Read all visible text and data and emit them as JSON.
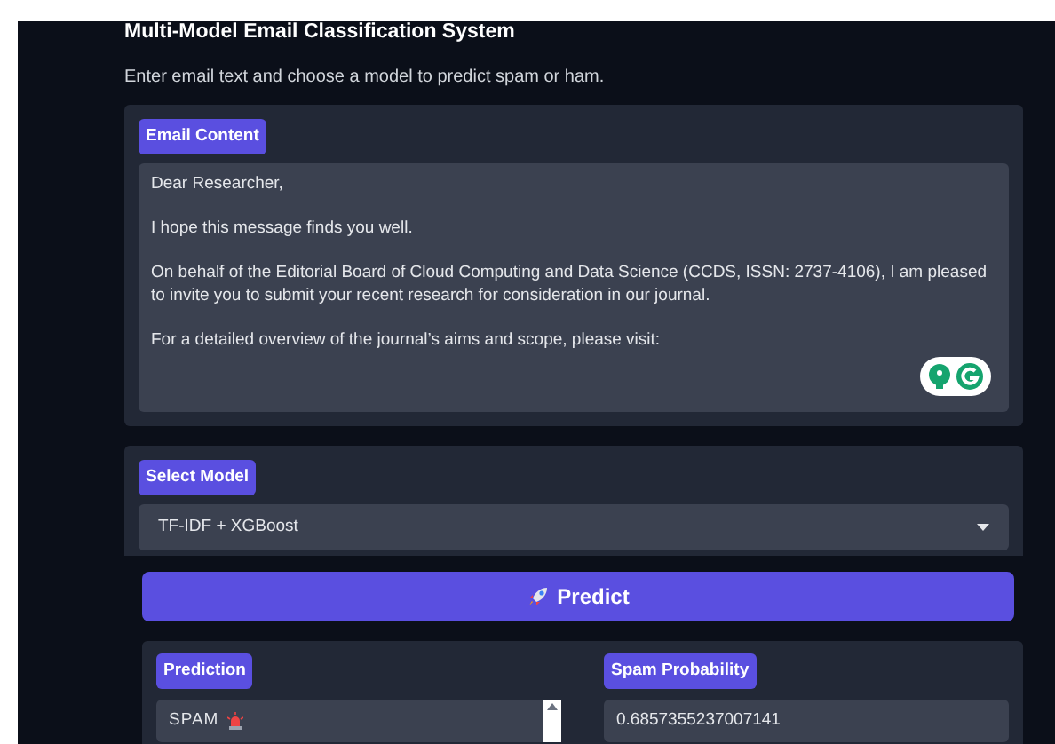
{
  "title": "Multi-Model Email Classification System",
  "description": "Enter email text and choose a model to predict spam or ham.",
  "email": {
    "label": "Email Content",
    "value": "Dear Researcher,\n\nI hope this message finds you well.\n\nOn behalf of the Editorial Board of Cloud Computing and Data Science (CCDS, ISSN: 2737-4106), I am pleased to invite you to submit your recent research for consideration in our journal.\n\nFor a detailed overview of the journal’s aims and scope, please visit:"
  },
  "model": {
    "label": "Select Model",
    "value": "TF-IDF + XGBoost"
  },
  "predict_button": "Predict",
  "outputs": [
    {
      "label": "Prediction",
      "value": "SPAM",
      "kind": "alert"
    },
    {
      "label": "Spam Probability",
      "value": "0.6857355237007141",
      "kind": "plain"
    }
  ]
}
